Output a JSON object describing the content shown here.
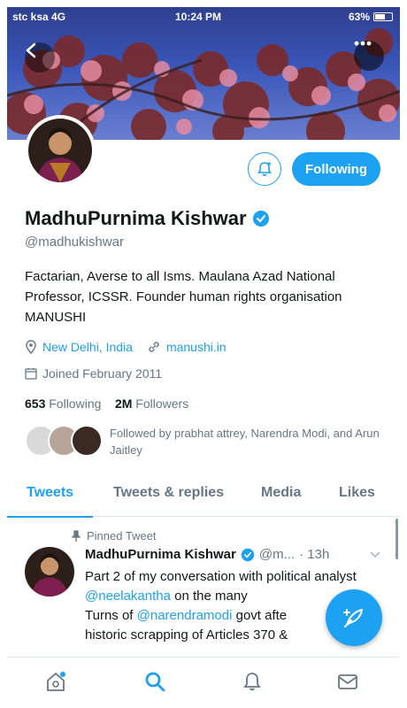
{
  "status_bar": {
    "carrier": "stc ksa 4G",
    "time": "10:24 PM",
    "battery": "63%",
    "battery_level": 0.63
  },
  "profile": {
    "name": "MadhuPurnima Kishwar",
    "handle": "@madhukishwar",
    "bio": "Factarian, Averse to all Isms. Maulana Azad National Professor, ICSSR. Founder human rights organisation MANUSHI",
    "location": "New Delhi, India",
    "website": "manushi.in",
    "joined": "Joined February 2011",
    "following_count": "653",
    "following_label": "Following",
    "followers_count": "2M",
    "followers_label": "Followers",
    "followed_by": "Followed by prabhat attrey, Narendra Modi, and Arun Jaitley",
    "verified_icon": "verified-badge-icon"
  },
  "actions": {
    "follow_label": "Following"
  },
  "tabs": [
    {
      "label": "Tweets",
      "active": true
    },
    {
      "label": "Tweets & replies",
      "active": false
    },
    {
      "label": "Media",
      "active": false
    },
    {
      "label": "Likes",
      "active": false
    }
  ],
  "pinned_tweet": {
    "pinned_label": "Pinned Tweet",
    "author": "MadhuPurnima Kishwar",
    "handle": "@m...",
    "time": "· 13h",
    "body_parts": {
      "p1": "Part 2 of my conversation with political analyst ",
      "mention1": "@neelakantha",
      "p2": " on the many",
      "p3": "Turns of ",
      "mention2": "@narendramodi",
      "p4": " govt afte",
      "p5": "historic scrapping of Articles 370 &"
    }
  },
  "colors": {
    "accent": "#1da1f2",
    "text": "#14171a",
    "secondary": "#657786"
  }
}
